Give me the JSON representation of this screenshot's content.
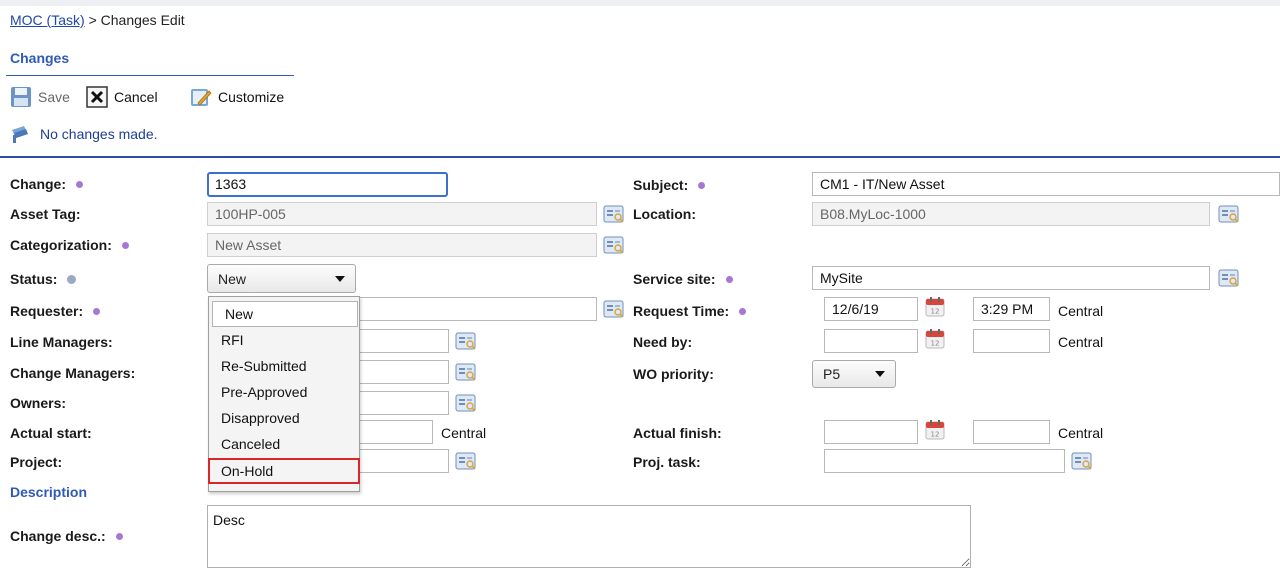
{
  "breadcrumb": {
    "link": "MOC (Task)",
    "separator": ">",
    "current": "Changes Edit"
  },
  "toolbar": {
    "section_title": "Changes",
    "save_label": "Save",
    "cancel_label": "Cancel",
    "customize_label": "Customize"
  },
  "message": {
    "text": "No changes made."
  },
  "form": {
    "change": {
      "label": "Change:",
      "value": "1363"
    },
    "asset_tag": {
      "label": "Asset Tag:",
      "value": "100HP-005"
    },
    "categorization": {
      "label": "Categorization:",
      "value": "New Asset"
    },
    "status": {
      "label": "Status:",
      "value": "New",
      "options": [
        "New",
        "RFI",
        "Re-Submitted",
        "Pre-Approved",
        "Disapproved",
        "Canceled",
        "On-Hold"
      ]
    },
    "requester": {
      "label": "Requester:",
      "value": ""
    },
    "line_managers": {
      "label": "Line Managers:",
      "value": ""
    },
    "change_managers": {
      "label": "Change Managers:",
      "value": ""
    },
    "owners": {
      "label": "Owners:",
      "value": ""
    },
    "actual_start": {
      "label": "Actual start:",
      "value": "",
      "timezone": "Central"
    },
    "project": {
      "label": "Project:",
      "value": ""
    },
    "subject": {
      "label": "Subject:",
      "value": "CM1 - IT/New Asset"
    },
    "location": {
      "label": "Location:",
      "value": "B08.MyLoc-1000"
    },
    "service_site": {
      "label": "Service site:",
      "value": "MySite"
    },
    "request_time": {
      "label": "Request Time:",
      "date": "12/6/19",
      "time": "3:29 PM",
      "timezone": "Central"
    },
    "need_by": {
      "label": "Need by:",
      "date": "",
      "time": "",
      "timezone": "Central"
    },
    "wo_priority": {
      "label": "WO priority:",
      "value": "P5"
    },
    "actual_finish": {
      "label": "Actual finish:",
      "date": "",
      "time": "",
      "timezone": "Central"
    },
    "proj_task": {
      "label": "Proj. task:",
      "value": ""
    }
  },
  "description": {
    "section_title": "Description",
    "label": "Change desc.:",
    "value": "Desc"
  },
  "colors": {
    "accent": "#2f5bb7",
    "highlight": "#d8262b",
    "required_dot": "#a678d6"
  }
}
